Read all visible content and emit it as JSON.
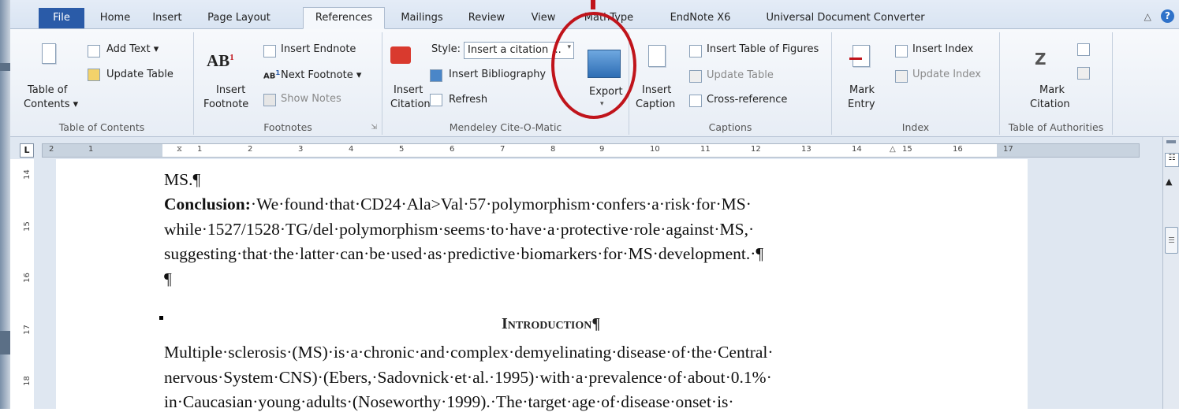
{
  "tabs": [
    {
      "label": "File"
    },
    {
      "label": "Home"
    },
    {
      "label": "Insert"
    },
    {
      "label": "Page Layout"
    },
    {
      "label": "References"
    },
    {
      "label": "Mailings"
    },
    {
      "label": "Review"
    },
    {
      "label": "View"
    },
    {
      "label": "MathType"
    },
    {
      "label": "EndNote X6"
    },
    {
      "label": "Universal Document Converter"
    }
  ],
  "ribbon": {
    "toc": {
      "table_of_label1": "Table of",
      "table_of_label2": "Contents ▾",
      "add_text": "Add Text ▾",
      "update_table": "Update Table",
      "group": "Table of Contents"
    },
    "footnotes": {
      "insert_footnote1": "Insert",
      "insert_footnote2": "Footnote",
      "insert_endnote": "Insert Endnote",
      "next_footnote": "Next Footnote ▾",
      "show_notes": "Show Notes",
      "group": "Footnotes"
    },
    "mendeley": {
      "insert_citation1": "Insert",
      "insert_citation2": "Citation",
      "style_label": "Style:",
      "style_value": "Insert a citation ...",
      "insert_bibliography": "Insert Bibliography",
      "refresh": "Refresh",
      "export": "Export",
      "group": "Mendeley Cite-O-Matic"
    },
    "captions": {
      "insert_caption1": "Insert",
      "insert_caption2": "Caption",
      "insert_table_figures": "Insert Table of Figures",
      "update_table": "Update Table",
      "cross_reference": "Cross-reference",
      "group": "Captions"
    },
    "index": {
      "mark_entry1": "Mark",
      "mark_entry2": "Entry",
      "insert_index": "Insert Index",
      "update_index": "Update Index",
      "group": "Index"
    },
    "authorities": {
      "mark_citation1": "Mark",
      "mark_citation2": "Citation",
      "group": "Table of Authorities"
    }
  },
  "ruler": {
    "corner": "L",
    "ticks": [
      "2",
      "1",
      "1",
      "2",
      "3",
      "4",
      "5",
      "6",
      "7",
      "8",
      "9",
      "10",
      "11",
      "12",
      "13",
      "14",
      "15",
      "16",
      "17"
    ]
  },
  "vruler": {
    "ticks": [
      "14",
      "15",
      "16",
      "17",
      "18"
    ]
  },
  "document": {
    "line1": "MS.¶",
    "conclusion_label": "Conclusion:",
    "conclusion_text": "·We·found·that·CD24·Ala>Val·57·polymorphism·confers·a·risk·for·MS·",
    "line3": "while·1527/1528·TG/del·polymorphism·seems·to·have·a·protective·role·against·MS,·",
    "line4": "suggesting·that·the·latter·can·be·used·as·predictive·biomarkers·for·MS·development.·¶",
    "line5": "¶",
    "heading": "Introduction¶",
    "line7": "Multiple·sclerosis·(MS)·is·a·chronic·and·complex·demyelinating·disease·of·the·Central·",
    "line8": "nervous·System·CNS)·(Ebers,·Sadovnick·et·al.·1995)·with·a·prevalence·of·about·0.1%·",
    "line9": "in·Caucasian·young·adults·(Noseworthy·1999).·The·target·age·of·disease·onset·is·"
  },
  "colors": {
    "file_tab": "#2a5ba8",
    "annotation": "#c0141b",
    "ribbon_bg": "#f1f5fa"
  }
}
